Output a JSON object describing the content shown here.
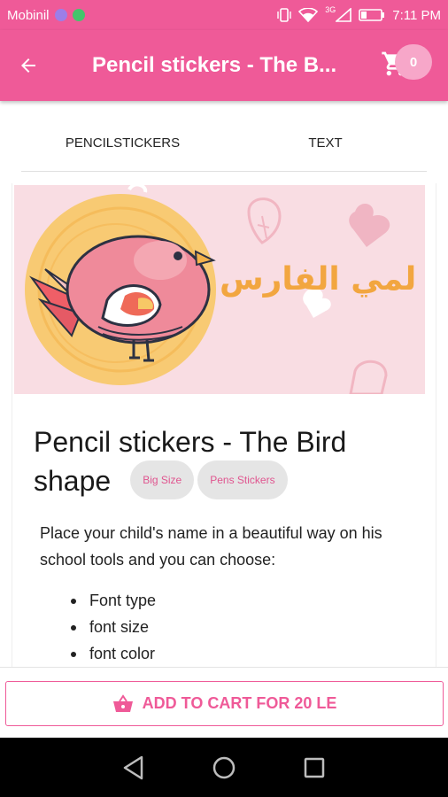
{
  "status_bar": {
    "carrier": "Mobinil",
    "network_label": "3G",
    "time": "7:11 PM"
  },
  "app_bar": {
    "title": "Pencil stickers - The B...",
    "cart_count": "0"
  },
  "tabs": [
    {
      "label": "PENCILSTICKERS"
    },
    {
      "label": "TEXT"
    }
  ],
  "product": {
    "image_text": "لمي الفارس",
    "title": "Pencil stickers - The Bird shape",
    "chips": [
      "Big Size",
      "Pens Stickers"
    ],
    "description": "Place your child's name in a beautiful way on his school tools and you can choose:",
    "features": [
      "Font type",
      "font size",
      "font color"
    ]
  },
  "action": {
    "add_to_cart_label": "ADD TO CART FOR 20 LE"
  },
  "colors": {
    "primary": "#ef5a98",
    "badge": "#f7a7c9",
    "chip_bg": "#e5e5e5",
    "hero_bg": "#f9dde3",
    "name_text": "#f2a640"
  },
  "icons": {
    "back": "arrow-left-icon",
    "cart": "shopping-cart-icon",
    "basket": "basket-icon",
    "nav_back": "triangle-back-icon",
    "nav_home": "circle-home-icon",
    "nav_recents": "square-recents-icon"
  }
}
